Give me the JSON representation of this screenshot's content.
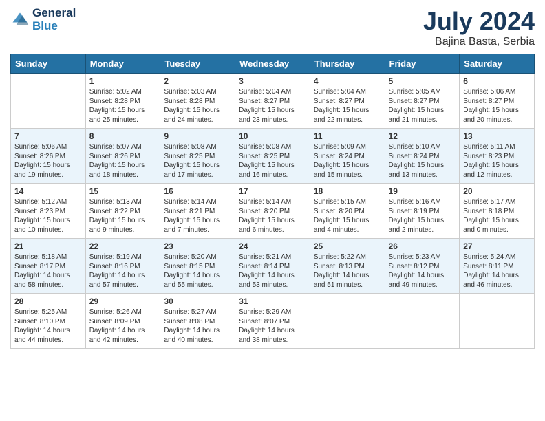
{
  "logo": {
    "line1": "General",
    "line2": "Blue"
  },
  "title": "July 2024",
  "subtitle": "Bajina Basta, Serbia",
  "weekdays": [
    "Sunday",
    "Monday",
    "Tuesday",
    "Wednesday",
    "Thursday",
    "Friday",
    "Saturday"
  ],
  "weeks": [
    [
      {
        "day": "",
        "sunrise": "",
        "sunset": "",
        "daylight": ""
      },
      {
        "day": "1",
        "sunrise": "Sunrise: 5:02 AM",
        "sunset": "Sunset: 8:28 PM",
        "daylight": "Daylight: 15 hours and 25 minutes."
      },
      {
        "day": "2",
        "sunrise": "Sunrise: 5:03 AM",
        "sunset": "Sunset: 8:28 PM",
        "daylight": "Daylight: 15 hours and 24 minutes."
      },
      {
        "day": "3",
        "sunrise": "Sunrise: 5:04 AM",
        "sunset": "Sunset: 8:27 PM",
        "daylight": "Daylight: 15 hours and 23 minutes."
      },
      {
        "day": "4",
        "sunrise": "Sunrise: 5:04 AM",
        "sunset": "Sunset: 8:27 PM",
        "daylight": "Daylight: 15 hours and 22 minutes."
      },
      {
        "day": "5",
        "sunrise": "Sunrise: 5:05 AM",
        "sunset": "Sunset: 8:27 PM",
        "daylight": "Daylight: 15 hours and 21 minutes."
      },
      {
        "day": "6",
        "sunrise": "Sunrise: 5:06 AM",
        "sunset": "Sunset: 8:27 PM",
        "daylight": "Daylight: 15 hours and 20 minutes."
      }
    ],
    [
      {
        "day": "7",
        "sunrise": "Sunrise: 5:06 AM",
        "sunset": "Sunset: 8:26 PM",
        "daylight": "Daylight: 15 hours and 19 minutes."
      },
      {
        "day": "8",
        "sunrise": "Sunrise: 5:07 AM",
        "sunset": "Sunset: 8:26 PM",
        "daylight": "Daylight: 15 hours and 18 minutes."
      },
      {
        "day": "9",
        "sunrise": "Sunrise: 5:08 AM",
        "sunset": "Sunset: 8:25 PM",
        "daylight": "Daylight: 15 hours and 17 minutes."
      },
      {
        "day": "10",
        "sunrise": "Sunrise: 5:08 AM",
        "sunset": "Sunset: 8:25 PM",
        "daylight": "Daylight: 15 hours and 16 minutes."
      },
      {
        "day": "11",
        "sunrise": "Sunrise: 5:09 AM",
        "sunset": "Sunset: 8:24 PM",
        "daylight": "Daylight: 15 hours and 15 minutes."
      },
      {
        "day": "12",
        "sunrise": "Sunrise: 5:10 AM",
        "sunset": "Sunset: 8:24 PM",
        "daylight": "Daylight: 15 hours and 13 minutes."
      },
      {
        "day": "13",
        "sunrise": "Sunrise: 5:11 AM",
        "sunset": "Sunset: 8:23 PM",
        "daylight": "Daylight: 15 hours and 12 minutes."
      }
    ],
    [
      {
        "day": "14",
        "sunrise": "Sunrise: 5:12 AM",
        "sunset": "Sunset: 8:23 PM",
        "daylight": "Daylight: 15 hours and 10 minutes."
      },
      {
        "day": "15",
        "sunrise": "Sunrise: 5:13 AM",
        "sunset": "Sunset: 8:22 PM",
        "daylight": "Daylight: 15 hours and 9 minutes."
      },
      {
        "day": "16",
        "sunrise": "Sunrise: 5:14 AM",
        "sunset": "Sunset: 8:21 PM",
        "daylight": "Daylight: 15 hours and 7 minutes."
      },
      {
        "day": "17",
        "sunrise": "Sunrise: 5:14 AM",
        "sunset": "Sunset: 8:20 PM",
        "daylight": "Daylight: 15 hours and 6 minutes."
      },
      {
        "day": "18",
        "sunrise": "Sunrise: 5:15 AM",
        "sunset": "Sunset: 8:20 PM",
        "daylight": "Daylight: 15 hours and 4 minutes."
      },
      {
        "day": "19",
        "sunrise": "Sunrise: 5:16 AM",
        "sunset": "Sunset: 8:19 PM",
        "daylight": "Daylight: 15 hours and 2 minutes."
      },
      {
        "day": "20",
        "sunrise": "Sunrise: 5:17 AM",
        "sunset": "Sunset: 8:18 PM",
        "daylight": "Daylight: 15 hours and 0 minutes."
      }
    ],
    [
      {
        "day": "21",
        "sunrise": "Sunrise: 5:18 AM",
        "sunset": "Sunset: 8:17 PM",
        "daylight": "Daylight: 14 hours and 58 minutes."
      },
      {
        "day": "22",
        "sunrise": "Sunrise: 5:19 AM",
        "sunset": "Sunset: 8:16 PM",
        "daylight": "Daylight: 14 hours and 57 minutes."
      },
      {
        "day": "23",
        "sunrise": "Sunrise: 5:20 AM",
        "sunset": "Sunset: 8:15 PM",
        "daylight": "Daylight: 14 hours and 55 minutes."
      },
      {
        "day": "24",
        "sunrise": "Sunrise: 5:21 AM",
        "sunset": "Sunset: 8:14 PM",
        "daylight": "Daylight: 14 hours and 53 minutes."
      },
      {
        "day": "25",
        "sunrise": "Sunrise: 5:22 AM",
        "sunset": "Sunset: 8:13 PM",
        "daylight": "Daylight: 14 hours and 51 minutes."
      },
      {
        "day": "26",
        "sunrise": "Sunrise: 5:23 AM",
        "sunset": "Sunset: 8:12 PM",
        "daylight": "Daylight: 14 hours and 49 minutes."
      },
      {
        "day": "27",
        "sunrise": "Sunrise: 5:24 AM",
        "sunset": "Sunset: 8:11 PM",
        "daylight": "Daylight: 14 hours and 46 minutes."
      }
    ],
    [
      {
        "day": "28",
        "sunrise": "Sunrise: 5:25 AM",
        "sunset": "Sunset: 8:10 PM",
        "daylight": "Daylight: 14 hours and 44 minutes."
      },
      {
        "day": "29",
        "sunrise": "Sunrise: 5:26 AM",
        "sunset": "Sunset: 8:09 PM",
        "daylight": "Daylight: 14 hours and 42 minutes."
      },
      {
        "day": "30",
        "sunrise": "Sunrise: 5:27 AM",
        "sunset": "Sunset: 8:08 PM",
        "daylight": "Daylight: 14 hours and 40 minutes."
      },
      {
        "day": "31",
        "sunrise": "Sunrise: 5:29 AM",
        "sunset": "Sunset: 8:07 PM",
        "daylight": "Daylight: 14 hours and 38 minutes."
      },
      {
        "day": "",
        "sunrise": "",
        "sunset": "",
        "daylight": ""
      },
      {
        "day": "",
        "sunrise": "",
        "sunset": "",
        "daylight": ""
      },
      {
        "day": "",
        "sunrise": "",
        "sunset": "",
        "daylight": ""
      }
    ]
  ]
}
